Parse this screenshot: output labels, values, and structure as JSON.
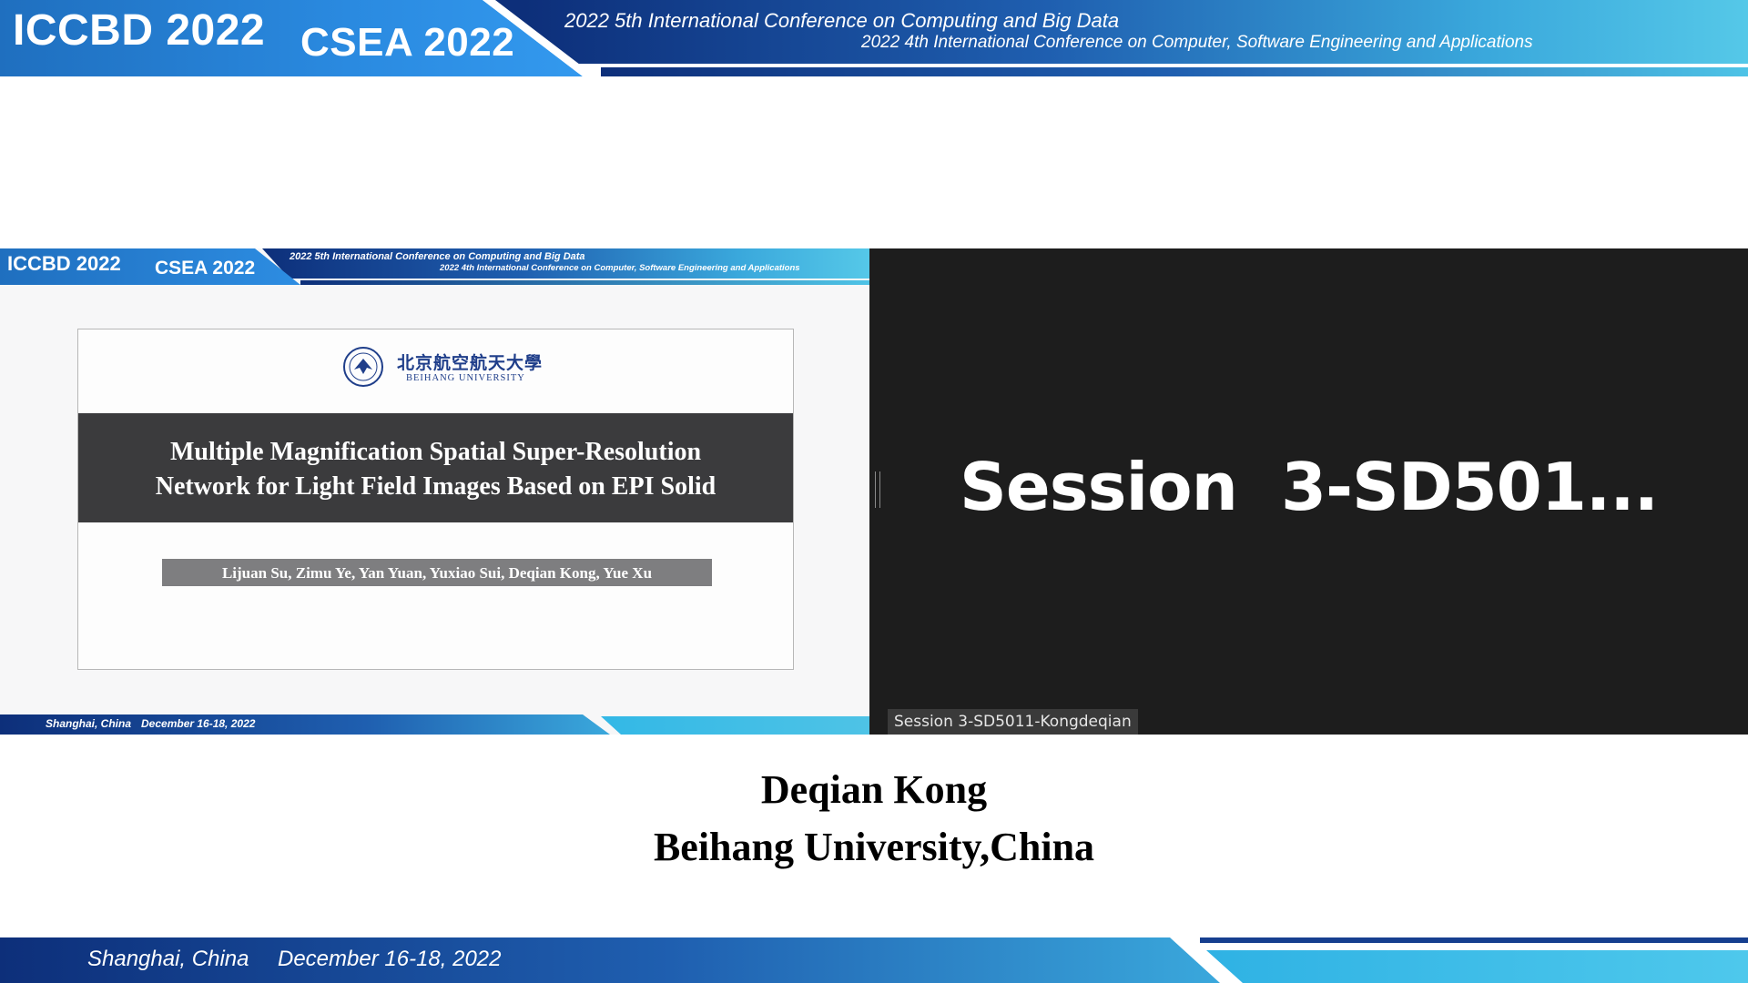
{
  "banner": {
    "title_primary": "ICCBD 2022",
    "title_secondary": "CSEA 2022",
    "conference_1": "2022 5th International Conference on Computing and Big Data",
    "conference_2": "2022 4th International Conference on Computer, Software Engineering and Applications"
  },
  "shared_slide": {
    "banner": {
      "title_primary": "ICCBD 2022",
      "title_secondary": "CSEA 2022",
      "conference_1": "2022 5th International Conference on Computing and Big Data",
      "conference_2": "2022 4th International Conference on Computer, Software Engineering and Applications"
    },
    "university_cn": "北京航空航天大學",
    "university_en": "BEIHANG UNIVERSITY",
    "paper_title_line1": "Multiple Magnification Spatial Super-Resolution",
    "paper_title_line2": "Network for Light Field Images Based on EPI Solid",
    "authors": "Lijuan Su, Zimu Ye, Yan Yuan, Yuxiao Sui, Deqian Kong, Yue Xu",
    "footer_location": "Shanghai, China",
    "footer_date": "December 16-18, 2022"
  },
  "participant": {
    "display_text": "Session  3-SD501...",
    "name_tag": "Session 3-SD5011-Kongdeqian"
  },
  "speaker": {
    "name": "Deqian Kong",
    "affiliation": "Beihang University,China"
  },
  "footer": {
    "location": "Shanghai, China",
    "date": "December 16-18, 2022"
  },
  "colors": {
    "banner_blue": "#1f6fbf",
    "banner_navy": "#0d2f7a",
    "banner_cyan": "#4ec3e6",
    "video_bg": "#1d1d1d"
  }
}
